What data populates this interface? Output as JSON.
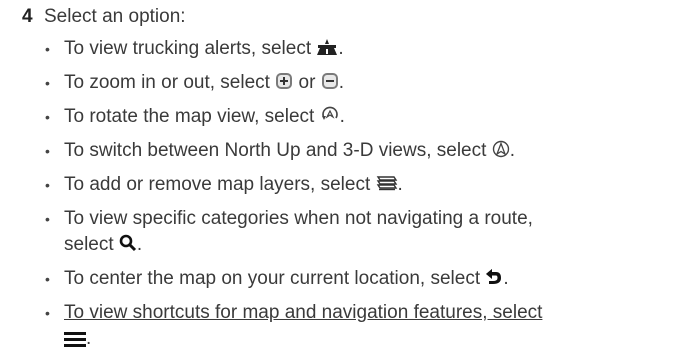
{
  "step": {
    "number": "4",
    "text": "Select an option:"
  },
  "options": [
    {
      "text": "To view trucking alerts, select",
      "icon": "trucking-alerts-icon",
      "suffix": "."
    },
    {
      "text_a": "To zoom in or out, select",
      "icon_a": "zoom-in-icon",
      "mid": "or",
      "icon_b": "zoom-out-icon",
      "suffix": "."
    },
    {
      "text": "To rotate the map view, select",
      "icon": "rotate-map-icon",
      "suffix": "."
    },
    {
      "text": "To switch between North Up and 3-D views, select",
      "icon": "north-up-3d-icon",
      "suffix": "."
    },
    {
      "text": "To add or remove map layers, select",
      "icon": "map-layers-icon",
      "suffix": "."
    },
    {
      "text_line1": "To view specific categories when not navigating a route,",
      "text_line2": "select",
      "icon": "search-icon",
      "suffix": "."
    },
    {
      "text": "To center the map on your current location, select",
      "icon": "center-location-icon",
      "suffix": "."
    },
    {
      "text_line1": "To view shortcuts for map and navigation features, select",
      "icon": "menu-icon",
      "suffix": "."
    }
  ],
  "bullet_char": "•"
}
